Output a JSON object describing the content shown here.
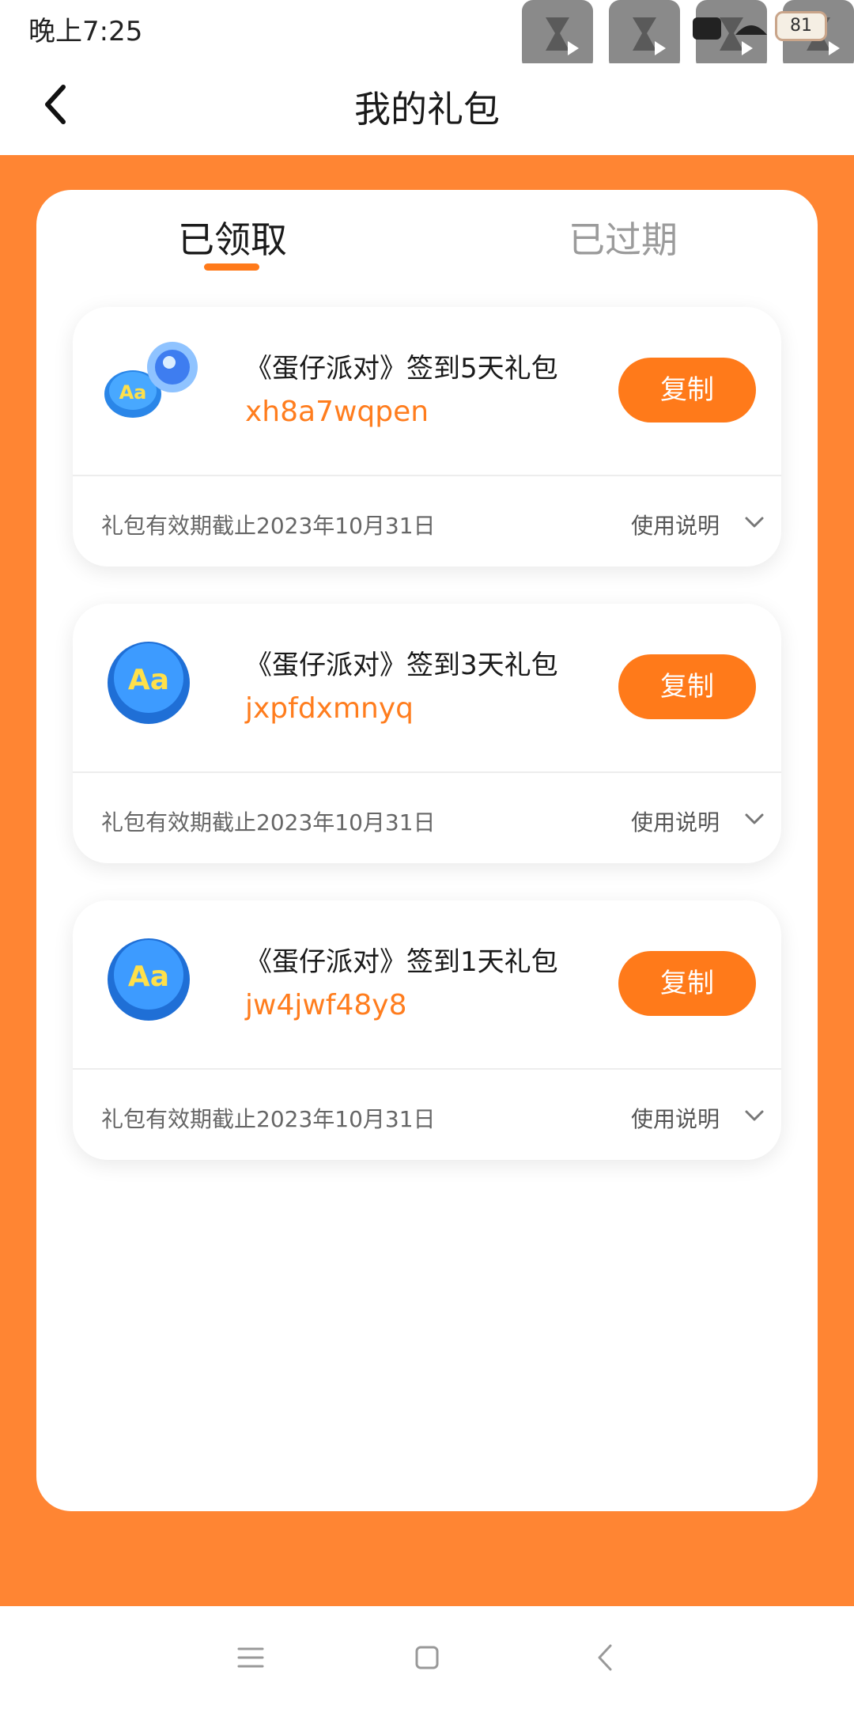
{
  "status_bar": {
    "time": "晚上7:25",
    "battery": "81",
    "icons": [
      "floating-video-icon",
      "signal-icon",
      "wifi-icon",
      "battery-icon"
    ]
  },
  "header": {
    "title": "我的礼包",
    "back_icon": "back-arrow-icon"
  },
  "tabs": [
    {
      "label": "已领取",
      "active": true
    },
    {
      "label": "已过期",
      "active": false
    }
  ],
  "gifts": [
    {
      "name": "《蛋仔派对》签到5天礼包",
      "code": "xh8a7wqpen",
      "copy_label": "复制",
      "expiry": "礼包有效期截止2023年10月31日",
      "usage_label": "使用说明",
      "icon": "bottle-cap-with-gem-icon"
    },
    {
      "name": "《蛋仔派对》签到3天礼包",
      "code": "jxpfdxmnyq",
      "copy_label": "复制",
      "expiry": "礼包有效期截止2023年10月31日",
      "usage_label": "使用说明",
      "icon": "bottle-cap-icon"
    },
    {
      "name": "《蛋仔派对》签到1天礼包",
      "code": "jw4jwf48y8",
      "copy_label": "复制",
      "expiry": "礼包有效期截止2023年10月31日",
      "usage_label": "使用说明",
      "icon": "bottle-cap-icon"
    }
  ],
  "bottom_nav": [
    "menu-icon",
    "home-icon",
    "back-icon"
  ],
  "colors": {
    "accent": "#ff7a1a",
    "background": "#ff8533",
    "code_text": "#ff7d1e"
  }
}
